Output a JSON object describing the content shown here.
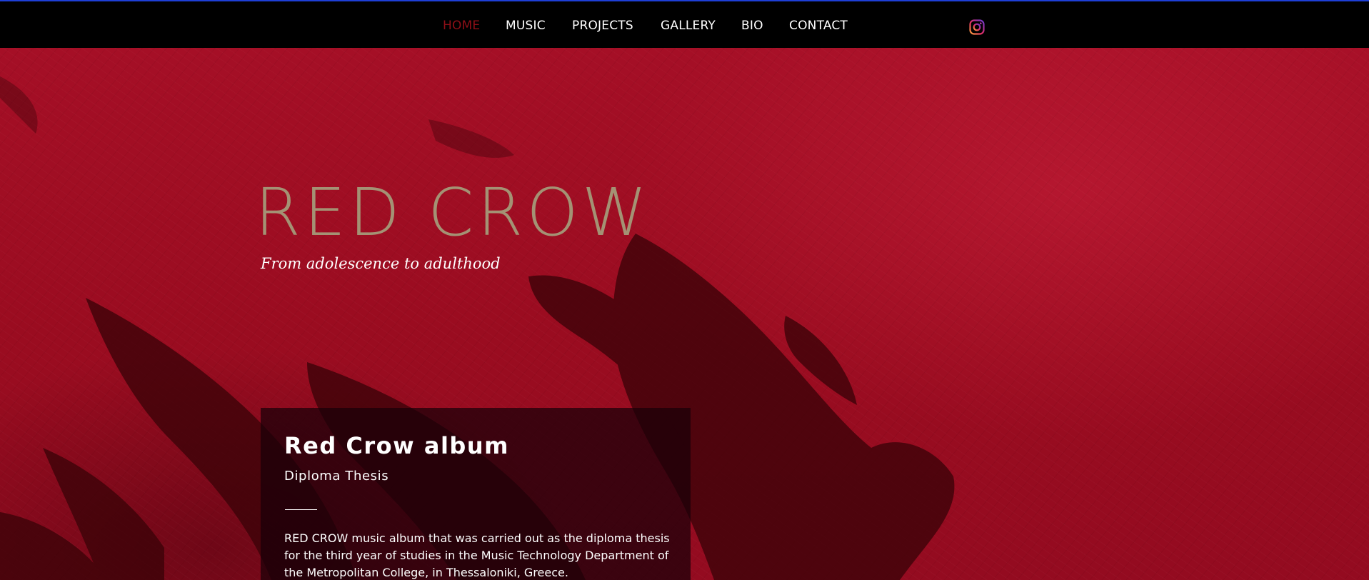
{
  "nav": {
    "items": [
      {
        "label": "HOME",
        "active": true
      },
      {
        "label": "MUSIC"
      },
      {
        "label": "PROJECTS"
      },
      {
        "label": "GALLERY"
      },
      {
        "label": "BIO"
      },
      {
        "label": "CONTACT"
      }
    ],
    "social_icon": "instagram-icon"
  },
  "hero": {
    "title": "RED CROW",
    "subtitle": "From adolescence to adulthood"
  },
  "card": {
    "title": "Red Crow album",
    "subtitle": "Diploma Thesis",
    "body": "RED CROW music album that was carried out as the diploma thesis for the third year of studies in the Music Technology Department of the Metropolitan College, in Thessaloniki, Greece."
  },
  "colors": {
    "nav_background": "#000000",
    "top_accent": "#1e3fd6",
    "active_nav": "#8e0f17",
    "hero_red": "#a50f26",
    "title_color": "#a49274",
    "card_background": "#19000899"
  }
}
